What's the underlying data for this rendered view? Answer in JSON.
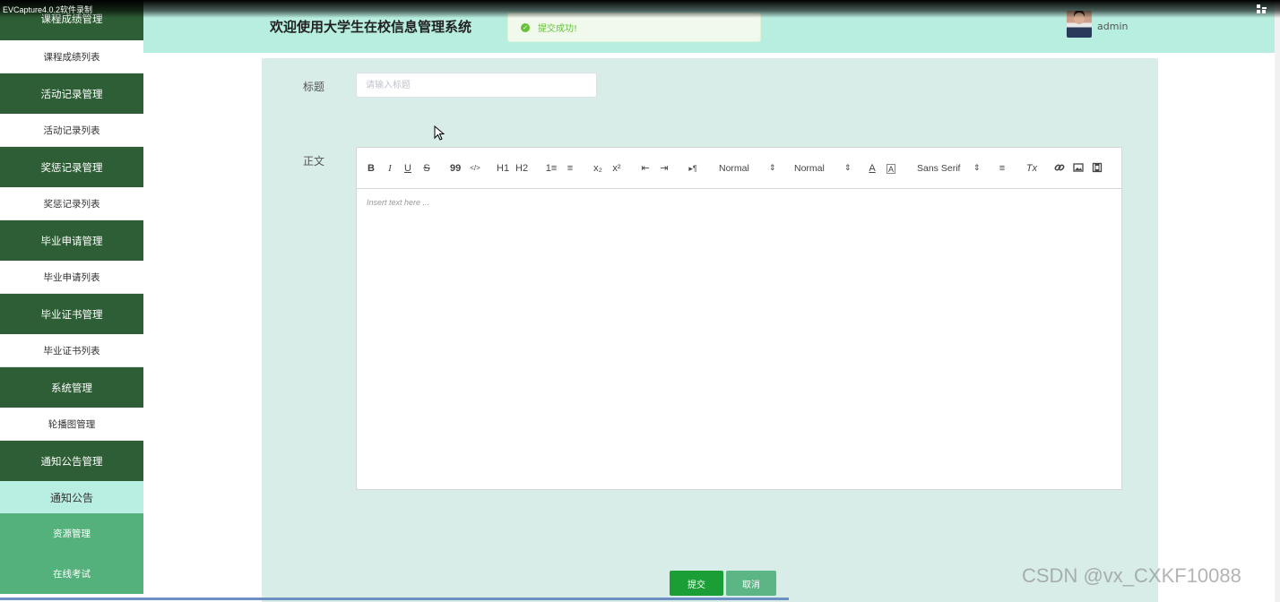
{
  "recorder": {
    "title": "EVCapture4.0.2软件录制"
  },
  "sidebar": {
    "items": [
      {
        "label": "课程成绩管理",
        "kind": "group"
      },
      {
        "label": "课程成绩列表",
        "kind": "sub"
      },
      {
        "label": "活动记录管理",
        "kind": "group"
      },
      {
        "label": "活动记录列表",
        "kind": "sub"
      },
      {
        "label": "奖惩记录管理",
        "kind": "group"
      },
      {
        "label": "奖惩记录列表",
        "kind": "sub"
      },
      {
        "label": "毕业申请管理",
        "kind": "group"
      },
      {
        "label": "毕业申请列表",
        "kind": "sub"
      },
      {
        "label": "毕业证书管理",
        "kind": "group"
      },
      {
        "label": "毕业证书列表",
        "kind": "sub"
      },
      {
        "label": "系统管理",
        "kind": "group"
      },
      {
        "label": "轮播图管理",
        "kind": "sub"
      },
      {
        "label": "通知公告管理",
        "kind": "group"
      },
      {
        "label": "通知公告",
        "kind": "active"
      },
      {
        "label": "资源管理",
        "kind": "light"
      },
      {
        "label": "在线考试",
        "kind": "light"
      }
    ]
  },
  "header": {
    "title": "欢迎使用大学生在校信息管理系统",
    "toast": "提交成功!",
    "username": "admin"
  },
  "form": {
    "title_label": "标题",
    "title_placeholder": "请输入标题",
    "content_label": "正文",
    "editor_placeholder": "Insert text here ...",
    "toolbar": {
      "bold": "B",
      "italic": "I",
      "underline": "U",
      "strike": "S",
      "blockquote": "99",
      "code": "</>",
      "h1": "H1",
      "h2": "H2",
      "ordered_list": "1≡",
      "bullet_list": "≡",
      "subscript": "x₂",
      "superscript": "x²",
      "outdent": "⇤",
      "indent": "⇥",
      "direction": "▸¶",
      "size": "Normal",
      "header": "Normal",
      "color": "A",
      "background": "A",
      "font": "Sans Serif",
      "align": "≡",
      "clean": "Tx"
    },
    "submit_label": "提交",
    "cancel_label": "取消"
  },
  "watermark": "CSDN @vx_CXKF10088",
  "colors": {
    "sidebar_group": "#2e5e35",
    "sidebar_active": "#b9efe3",
    "sidebar_light": "#54b17c",
    "header_bg": "#b8eee0",
    "panel_bg": "#d8ede8",
    "submit": "#1a9e35",
    "cancel": "#5bb585"
  }
}
